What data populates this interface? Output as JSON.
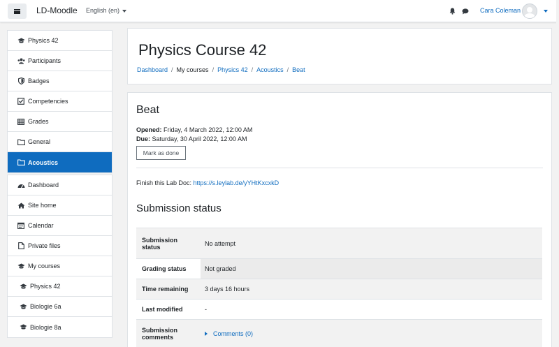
{
  "navbar": {
    "brand": "LD-Moodle",
    "language": "English (en)",
    "user_name": "Cara Coleman"
  },
  "sidebar": {
    "course_items": [
      {
        "label": "Physics 42",
        "icon": "graduation-cap-icon"
      },
      {
        "label": "Participants",
        "icon": "users-icon"
      },
      {
        "label": "Badges",
        "icon": "shield-icon"
      },
      {
        "label": "Competencies",
        "icon": "checkbox-icon"
      },
      {
        "label": "Grades",
        "icon": "table-icon"
      },
      {
        "label": "General",
        "icon": "folder-icon"
      },
      {
        "label": "Acoustics",
        "icon": "folder-icon",
        "active": true
      }
    ],
    "site_items": [
      {
        "label": "Dashboard",
        "icon": "dashboard-icon"
      },
      {
        "label": "Site home",
        "icon": "home-icon"
      },
      {
        "label": "Calendar",
        "icon": "calendar-icon"
      },
      {
        "label": "Private files",
        "icon": "file-icon"
      },
      {
        "label": "My courses",
        "icon": "graduation-cap-icon"
      },
      {
        "label": "Physics 42",
        "icon": "graduation-cap-icon"
      },
      {
        "label": "Biologie 6a",
        "icon": "graduation-cap-icon"
      },
      {
        "label": "Biologie 8a",
        "icon": "graduation-cap-icon"
      }
    ]
  },
  "header": {
    "title": "Physics Course 42",
    "breadcrumb": [
      "Dashboard",
      "My courses",
      "Physics 42",
      "Acoustics",
      "Beat"
    ]
  },
  "activity": {
    "title": "Beat",
    "opened_label": "Opened:",
    "opened_value": "Friday, 4 March 2022, 12:00 AM",
    "due_label": "Due:",
    "due_value": "Saturday, 30 April 2022, 12:00 AM",
    "mark_done": "Mark as done",
    "intro_text": "Finish this Lab Doc: ",
    "intro_link": "https://s.leylab.de/yYHtKxcxkD"
  },
  "submission": {
    "heading": "Submission status",
    "rows": [
      {
        "label": "Submission status",
        "value": "No attempt"
      },
      {
        "label": "Grading status",
        "value": "Not graded"
      },
      {
        "label": "Time remaining",
        "value": "3 days 16 hours"
      },
      {
        "label": "Last modified",
        "value": "-"
      },
      {
        "label": "Submission comments",
        "value": "Comments (0)"
      }
    ]
  },
  "colors": {
    "primary": "#0f6cbf",
    "active_nav_bg": "#0f6cbf",
    "page_bg": "#f2f2f2"
  }
}
